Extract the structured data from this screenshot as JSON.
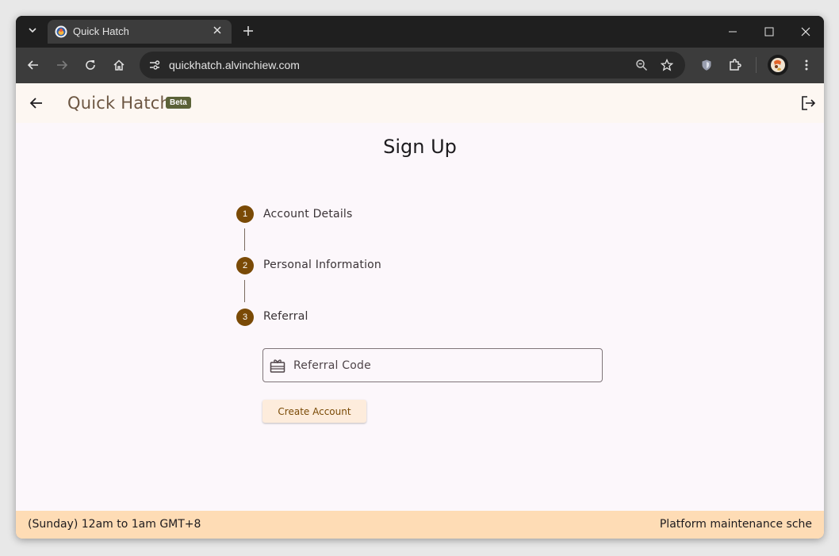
{
  "browser": {
    "tab_title": "Quick Hatch",
    "url": "quickhatch.alvinchiew.com",
    "icons": [
      "tab-search-icon",
      "favicon-icon",
      "close-icon",
      "plus-icon",
      "minimize-icon",
      "maximize-icon",
      "close-window-icon",
      "back-icon",
      "forward-icon",
      "reload-icon",
      "home-icon",
      "site-settings-icon",
      "zoom-icon",
      "star-icon",
      "shield-icon",
      "extensions-icon",
      "profile-avatar",
      "more-vert-icon"
    ]
  },
  "appbar": {
    "title": "Quick Hatch",
    "badge": "Beta"
  },
  "main": {
    "heading": "Sign Up",
    "steps": [
      {
        "number": "1",
        "label": "Account Details"
      },
      {
        "number": "2",
        "label": "Personal Information"
      },
      {
        "number": "3",
        "label": "Referral"
      }
    ],
    "referral_field": {
      "placeholder": "Referral Code",
      "value": ""
    },
    "create_button": "Create Account"
  },
  "footer": {
    "left_text": "(Sunday) 12am to 1am GMT+8",
    "right_text": "Platform maintenance sche"
  },
  "colors": {
    "accent": "#7a4a06",
    "beta_badge": "#5b6238",
    "footer_bg": "#fedcb5",
    "page_bg": "#fcf7fb"
  }
}
